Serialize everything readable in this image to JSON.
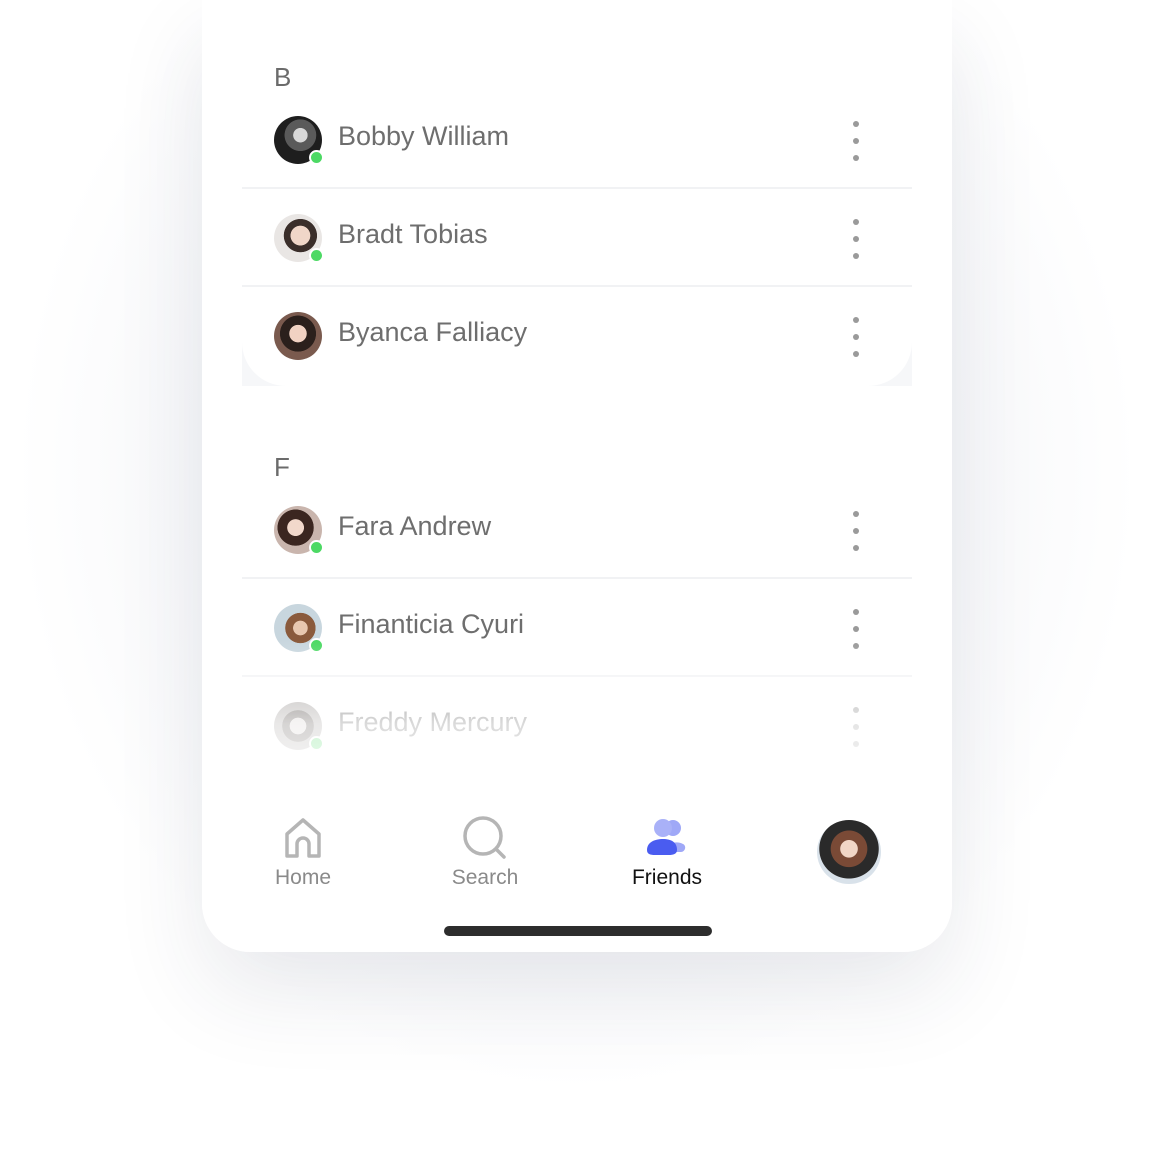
{
  "sections": [
    {
      "letter": "B",
      "contacts": [
        {
          "name": "Bobby William",
          "online": true
        },
        {
          "name": "Bradt Tobias",
          "online": true
        },
        {
          "name": "Byanca Falliacy",
          "online": false
        }
      ]
    },
    {
      "letter": "F",
      "contacts": [
        {
          "name": "Fara Andrew",
          "online": true
        },
        {
          "name": "Financticia Cyuri",
          "online": true
        },
        {
          "name": "Freddy Mercury",
          "online": true
        }
      ]
    }
  ],
  "tabbar": {
    "home_label": "Home",
    "search_label": "Search",
    "friends_label": "Friends",
    "active_tab": "Friends"
  },
  "icons": {
    "home": "home-icon",
    "search": "search-icon",
    "friends": "friends-icon",
    "more": "more-vertical-icon"
  },
  "colors": {
    "online": "#4cd964",
    "accent": "#4a5cf0",
    "accent_light": "#9fa8f7",
    "text_muted": "#6e6e6e"
  }
}
